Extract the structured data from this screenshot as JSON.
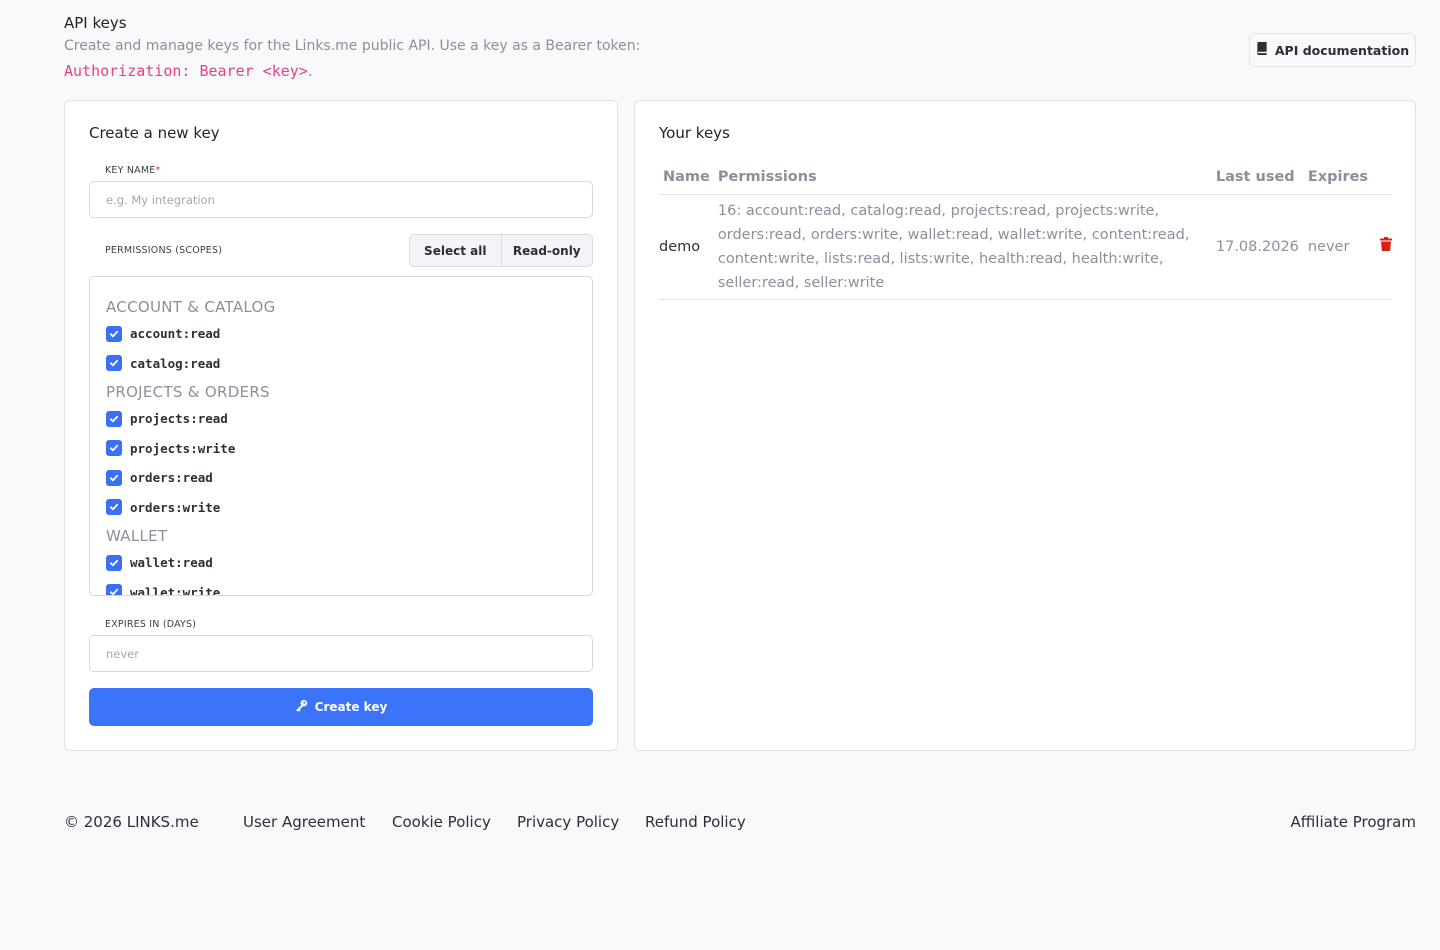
{
  "header": {
    "title": "API keys",
    "description": "Create and manage keys for the Links.me public API. Use a key as a Bearer token:",
    "auth_code": "Authorization: Bearer <key>",
    "auth_suffix": ".",
    "doc_button": "API documentation",
    "doc_icon": "book-icon"
  },
  "create": {
    "title": "Create a new key",
    "key_name_label": "KEY NAME",
    "key_name_required": "*",
    "key_name_placeholder": "e.g. My integration",
    "key_name_value": "",
    "permissions_label": "PERMISSIONS (SCOPES)",
    "select_all": "Select all",
    "read_only": "Read-only",
    "groups": [
      {
        "title": "ACCOUNT & CATALOG",
        "items": [
          {
            "name": "account:read",
            "checked": true
          },
          {
            "name": "catalog:read",
            "checked": true
          }
        ]
      },
      {
        "title": "PROJECTS & ORDERS",
        "items": [
          {
            "name": "projects:read",
            "checked": true
          },
          {
            "name": "projects:write",
            "checked": true
          },
          {
            "name": "orders:read",
            "checked": true
          },
          {
            "name": "orders:write",
            "checked": true
          }
        ]
      },
      {
        "title": "WALLET",
        "items": [
          {
            "name": "wallet:read",
            "checked": true
          },
          {
            "name": "wallet:write",
            "checked": true
          }
        ]
      }
    ],
    "expires_label": "EXPIRES IN (DAYS)",
    "expires_placeholder": "never",
    "expires_value": "",
    "create_button": "Create key",
    "create_icon": "key-icon"
  },
  "keys": {
    "title": "Your keys",
    "columns": [
      "Name",
      "Permissions",
      "Last used",
      "Expires"
    ],
    "rows": [
      {
        "name": "demo",
        "permissions": "16: account:read, catalog:read, projects:read, projects:write, orders:read, orders:write, wallet:read, wallet:write, content:read, content:write, lists:read, lists:write, health:read, health:write, seller:read, seller:write",
        "last_used": "17.08.2026",
        "expires": "never",
        "delete_icon": "trash-icon"
      }
    ]
  },
  "footer": {
    "copyright": "© 2026 LINKS.me",
    "links": [
      "User Agreement",
      "Cookie Policy",
      "Privacy Policy",
      "Refund Policy"
    ],
    "affiliate": "Affiliate Program"
  },
  "colors": {
    "accent": "#3b74fb",
    "code": "#e83e8c",
    "danger": "#dc1f12",
    "muted": "#8a909c",
    "checkbox": "#3b6ff5"
  }
}
